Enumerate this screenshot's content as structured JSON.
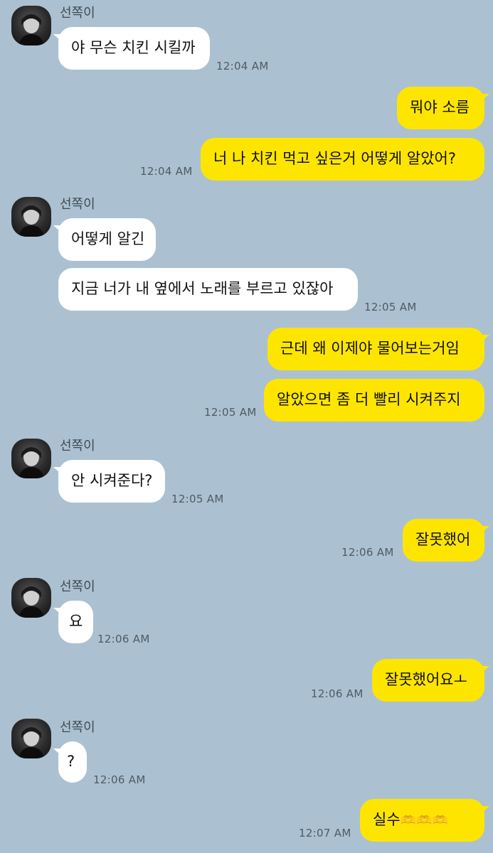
{
  "contact": {
    "name": "선쪽이"
  },
  "messages": [
    {
      "id": 1,
      "text": "야 무슨 치킨 시킬까",
      "time": "12:04 AM"
    },
    {
      "id": 2,
      "text": "뭐야 소름"
    },
    {
      "id": 3,
      "text": "너 나 치킨 먹고 싶은거 어떻게 알았어?",
      "time": "12:04 AM"
    },
    {
      "id": 4,
      "text": "어떻게 알긴"
    },
    {
      "id": 5,
      "text": "지금 너가 내 옆에서 노래를 부르고 있잖아",
      "time": "12:05 AM"
    },
    {
      "id": 6,
      "text": "근데 왜 이제야 물어보는거임"
    },
    {
      "id": 7,
      "text": "알았으면 좀 더 빨리 시켜주지",
      "time": "12:05 AM"
    },
    {
      "id": 8,
      "text": "안 시켜준다?",
      "time": "12:05 AM"
    },
    {
      "id": 9,
      "text": "잘못했어",
      "time": "12:06 AM"
    },
    {
      "id": 10,
      "text": "요",
      "time": "12:06 AM"
    },
    {
      "id": 11,
      "text": "잘못했어요ㅗ",
      "time": "12:06 AM"
    },
    {
      "id": 12,
      "text": "?",
      "time": "12:06 AM"
    },
    {
      "id": 13,
      "text": "실수",
      "emoji": "🫶🫶🫶",
      "time": "12:07 AM"
    }
  ]
}
